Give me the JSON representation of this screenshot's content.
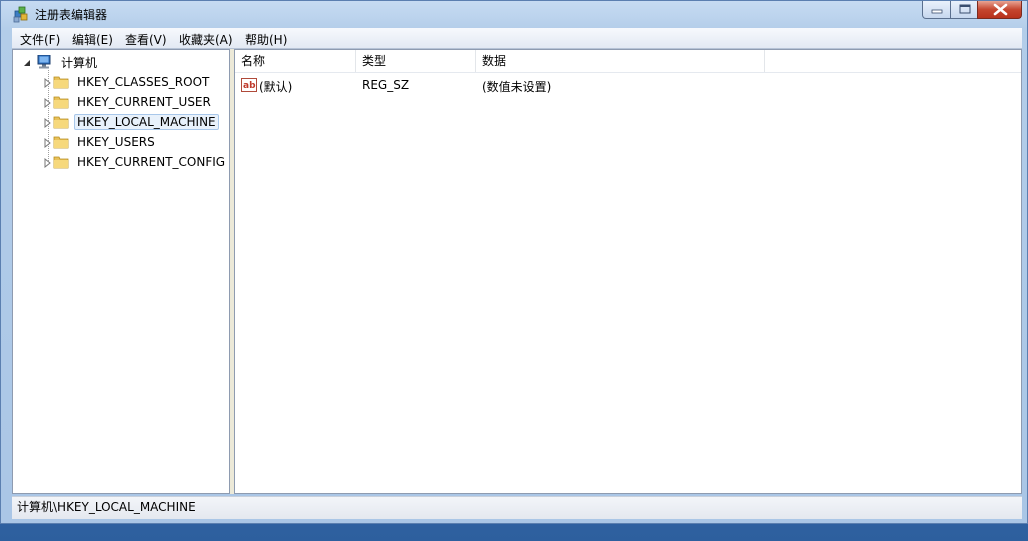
{
  "window": {
    "title": "注册表编辑器",
    "accent": "#b3cde9"
  },
  "menu": [
    {
      "label": "文件(F)"
    },
    {
      "label": "编辑(E)"
    },
    {
      "label": "查看(V)"
    },
    {
      "label": "收藏夹(A)"
    },
    {
      "label": "帮助(H)"
    }
  ],
  "tree": {
    "root": {
      "label": "计算机",
      "icon": "computer-icon"
    },
    "keys": [
      {
        "label": "HKEY_CLASSES_ROOT",
        "icon": "folder-icon"
      },
      {
        "label": "HKEY_CURRENT_USER",
        "icon": "folder-icon"
      },
      {
        "label": "HKEY_LOCAL_MACHINE",
        "icon": "folder-icon",
        "selected": true
      },
      {
        "label": "HKEY_USERS",
        "icon": "folder-icon"
      },
      {
        "label": "HKEY_CURRENT_CONFIG",
        "icon": "folder-icon"
      }
    ]
  },
  "list": {
    "columns": [
      "名称",
      "类型",
      "数据"
    ],
    "rows": [
      {
        "icon": "string-value-icon",
        "name": "(默认)",
        "type": "REG_SZ",
        "data": "(数值未设置)"
      }
    ]
  },
  "status": {
    "path": "计算机\\HKEY_LOCAL_MACHINE"
  }
}
